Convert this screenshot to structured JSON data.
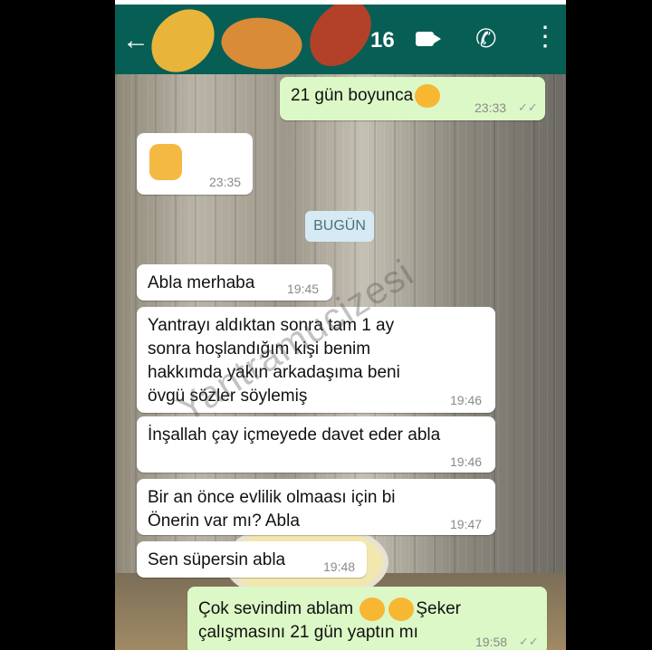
{
  "header": {
    "title_visible": "16",
    "icons": [
      "back-arrow-icon",
      "video-call-icon",
      "phone-icon",
      "more-vert-icon"
    ]
  },
  "date_chip": "BUGÜN",
  "messages": [
    {
      "dir": "out",
      "text": "21 gün boyunca",
      "emoji": "hug-emoji",
      "time": "23:33"
    },
    {
      "dir": "in",
      "text": "",
      "emoji": "thumbs-up-emoji",
      "time": "23:35"
    },
    {
      "dir": "in",
      "text": "Abla merhaba",
      "time": "19:45"
    },
    {
      "dir": "in",
      "text": "Yantrayı aldıktan sonra tam 1 ay\nsonra hoşlandığım kişi benim\nhakkımda yakın arkadaşıma beni\növgü sözler söylemiş",
      "time": "19:46"
    },
    {
      "dir": "in",
      "text": "İnşallah çay içmeyede davet eder abla",
      "time": "19:46"
    },
    {
      "dir": "in",
      "text": "Bir an önce evlilik olmaası için bi\nÖnerin var mı? Abla",
      "time": "19:47"
    },
    {
      "dir": "in",
      "text": "Sen süpersin abla",
      "time": "19:48"
    },
    {
      "dir": "out",
      "text_a": "Çok sevindim ablam",
      "text_b": "Şeker",
      "text_c": "çalışmasını 21 gün yaptın mı",
      "emoji": "smiling-hearts-emoji",
      "time": "19:58"
    }
  ],
  "watermark": "Yantramucizesi",
  "colors": {
    "app_bar": "#075e54",
    "incoming": "#ffffff",
    "outgoing": "#dcf8c6"
  }
}
